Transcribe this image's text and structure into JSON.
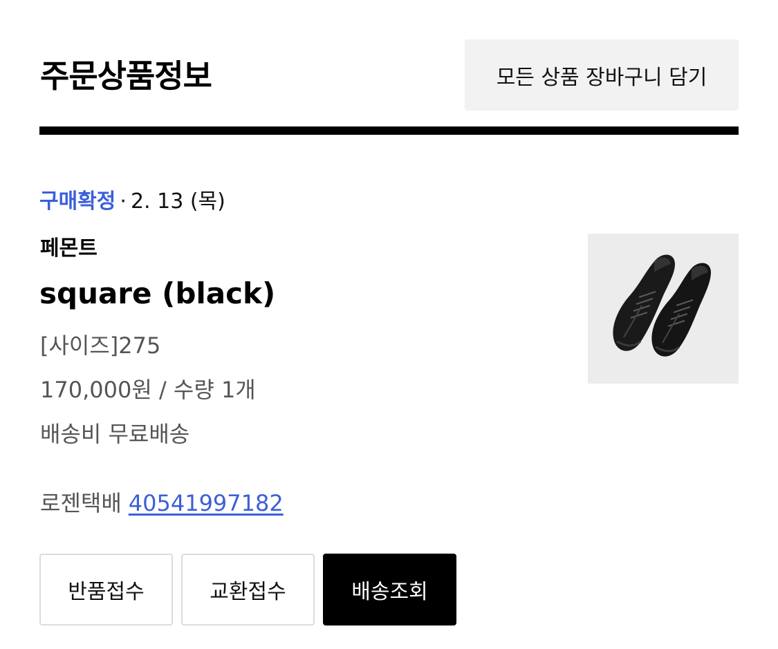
{
  "header": {
    "title": "주문상품정보",
    "cart_all_label": "모든 상품 장바구니 담기"
  },
  "order": {
    "status_label": "구매확정",
    "status_separator": "·",
    "status_date": "2. 13 (목)",
    "brand": "페몬트",
    "product_name": "square (black)",
    "option": "[사이즈]275",
    "price_qty": "170,000원 / 수량 1개",
    "shipping": "배송비 무료배송",
    "courier": "로젠택배",
    "tracking_number": "40541997182",
    "image_icon": "black-shoes-product-image"
  },
  "actions": {
    "return_label": "반품접수",
    "exchange_label": "교환접수",
    "track_label": "배송조회"
  },
  "colors": {
    "accent": "#3b5fd9",
    "primary_button": "#000000",
    "secondary_bg": "#f2f2f2"
  }
}
